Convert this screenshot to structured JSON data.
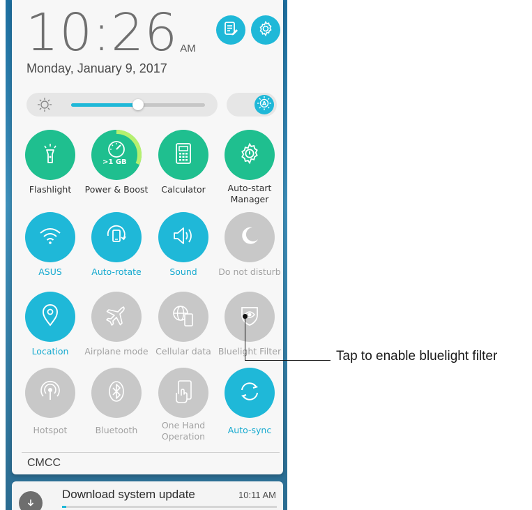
{
  "status": {
    "time": "10:26",
    "ampm": "AM",
    "date": "Monday, January 9, 2017"
  },
  "top_buttons": [
    {
      "icon": "edit-note-icon"
    },
    {
      "icon": "settings-gear-icon"
    }
  ],
  "brightness": {
    "level_fraction": 0.5,
    "auto_enabled": true
  },
  "tiles": [
    {
      "label": "Flashlight",
      "state": "on-green",
      "icon": "flashlight-icon"
    },
    {
      "label": "Power & Boost",
      "state": "on-green",
      "icon": "speedometer-icon",
      "badge": ">1 GB"
    },
    {
      "label": "Calculator",
      "state": "on-green",
      "icon": "calculator-icon"
    },
    {
      "label": "Auto-start Manager",
      "state": "on-green",
      "icon": "autostart-gear-icon"
    },
    {
      "label": "ASUS",
      "state": "on-blue",
      "icon": "wifi-icon"
    },
    {
      "label": "Auto-rotate",
      "state": "on-blue",
      "icon": "rotate-icon"
    },
    {
      "label": "Sound",
      "state": "on-blue",
      "icon": "speaker-icon"
    },
    {
      "label": "Do not disturb",
      "state": "off",
      "icon": "moon-icon"
    },
    {
      "label": "Location",
      "state": "on-blue",
      "icon": "location-pin-icon"
    },
    {
      "label": "Airplane mode",
      "state": "off",
      "icon": "airplane-icon"
    },
    {
      "label": "Cellular data",
      "state": "off",
      "icon": "cellular-globe-icon"
    },
    {
      "label": "Bluelight Filter",
      "state": "off",
      "icon": "eye-shield-icon"
    },
    {
      "label": "Hotspot",
      "state": "off",
      "icon": "hotspot-icon"
    },
    {
      "label": "Bluetooth",
      "state": "off",
      "icon": "bluetooth-icon"
    },
    {
      "label": "One Hand Operation",
      "state": "off",
      "icon": "one-hand-icon"
    },
    {
      "label": "Auto-sync",
      "state": "on-blue",
      "icon": "sync-icon"
    }
  ],
  "carrier": "CMCC",
  "notification": {
    "title": "Download system update",
    "time": "10:11 AM",
    "progress_fraction": 0.02
  },
  "callout": {
    "text": "Tap to enable bluelight filter"
  },
  "colors": {
    "accent_blue": "#1fb8d8",
    "accent_green": "#1fbf8f",
    "disabled_grey": "#c8c8c8"
  }
}
